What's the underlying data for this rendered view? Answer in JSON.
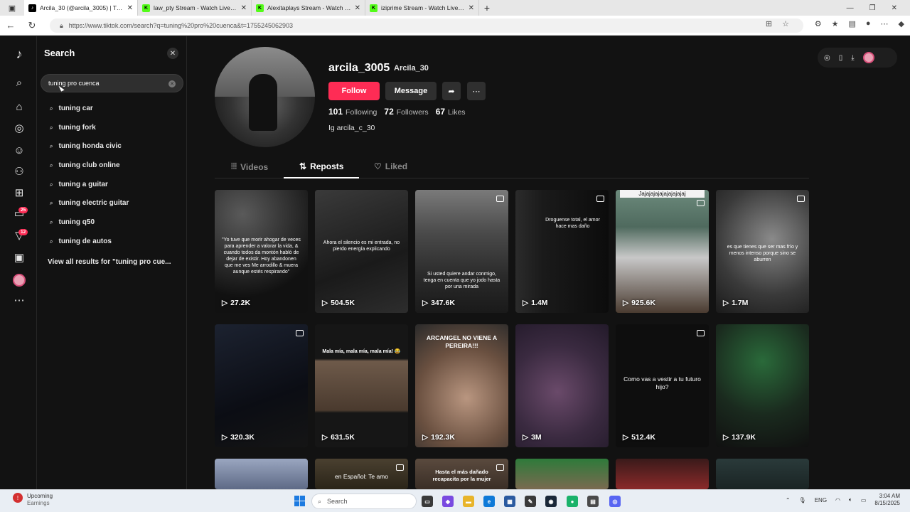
{
  "browser": {
    "tabs": [
      {
        "title": "Arcila_30 (@arcila_3005) | TikTok",
        "favicon": "tiktok-icon",
        "active": true
      },
      {
        "title": "law_pty Stream - Watch Live on K",
        "favicon": "kick-icon",
        "active": false
      },
      {
        "title": "Alexitaplays Stream - Watch Live",
        "favicon": "kick-icon",
        "active": false
      },
      {
        "title": "iziprime Stream - Watch Live on K",
        "favicon": "kick-icon",
        "active": false
      }
    ],
    "url": "https://www.tiktok.com/search?q=tuning%20pro%20cuenca&t=1755245062903"
  },
  "sidebar": {
    "badges": {
      "inbox": "25",
      "activity": "12"
    }
  },
  "search": {
    "title": "Search",
    "query": "tuning pro cuenca",
    "suggestions": [
      "tuning car",
      "tuning fork",
      "tuning honda civic",
      "tuning club online",
      "tuning a guitar",
      "tuning electric guitar",
      "tuning q50",
      "tuning de autos"
    ],
    "view_all": "View all results for \"tuning pro cue..."
  },
  "profile": {
    "username": "arcila_3005",
    "nickname": "Arcila_30",
    "follow_label": "Follow",
    "message_label": "Message",
    "following_count": "101",
    "following_label": "Following",
    "followers_count": "72",
    "followers_label": "Followers",
    "likes_count": "67",
    "likes_label": "Likes",
    "bio": "Ig arcila_c_30"
  },
  "tabs": {
    "videos": "Videos",
    "reposts": "Reposts",
    "liked": "Liked",
    "active": "Reposts"
  },
  "videos": [
    {
      "views": "27.2K",
      "caption": "\"Yo tuve que morir ahogar de veces para aprender a valorar la vida, & cuando todos da montón habló de dejar de existir. Hoy abandonen que me ves Me arrodillo & muera aunque estés respirando\"",
      "photo": false
    },
    {
      "views": "504.5K",
      "caption": "Ahora el silencio es mi entrada, no pierdo energía explicando",
      "photo": false
    },
    {
      "views": "347.6K",
      "caption": "Si usted quiere andar conmigo, tenga en cuenta que yo jodo hasta por una mirada",
      "photo": true
    },
    {
      "views": "1.4M",
      "caption": "Droguense total, el amor hace mas daño",
      "photo": true
    },
    {
      "views": "925.6K",
      "caption": "Jajajajajajajajajajaj",
      "photo": true
    },
    {
      "views": "1.7M",
      "caption": "es que tienes que ser mas frío y menos intenso porque sino se aburren",
      "photo": true
    },
    {
      "views": "320.3K",
      "caption": "",
      "photo": true
    },
    {
      "views": "631.5K",
      "caption": "Mala mía, mala mía, mala mía! 😂",
      "photo": false
    },
    {
      "views": "192.3K",
      "caption": "ARCANGEL NO VIENE A PEREIRA!!!",
      "photo": false
    },
    {
      "views": "3M",
      "caption": "",
      "photo": false
    },
    {
      "views": "512.4K",
      "caption": "Como vas a vestir a tu futuro hijo?",
      "photo": true
    },
    {
      "views": "137.9K",
      "caption": "",
      "photo": false
    },
    {
      "views": "",
      "caption": "",
      "photo": false
    },
    {
      "views": "",
      "caption": "en Español: Te amo",
      "photo": true
    },
    {
      "views": "",
      "caption": "Hasta el más dañado recapacita por la mujer",
      "photo": true
    },
    {
      "views": "",
      "caption": "",
      "photo": false
    },
    {
      "views": "",
      "caption": "",
      "photo": false
    },
    {
      "views": "",
      "caption": "",
      "photo": false
    }
  ],
  "taskbar": {
    "weather_title": "Upcoming",
    "weather_sub": "Earnings",
    "search_placeholder": "Search",
    "lang": "ENG",
    "time": "3:04 AM",
    "date": "8/15/2025"
  },
  "colors": {
    "accent": "#fe2c55",
    "background": "#121212",
    "surface": "#2f2f2f"
  }
}
